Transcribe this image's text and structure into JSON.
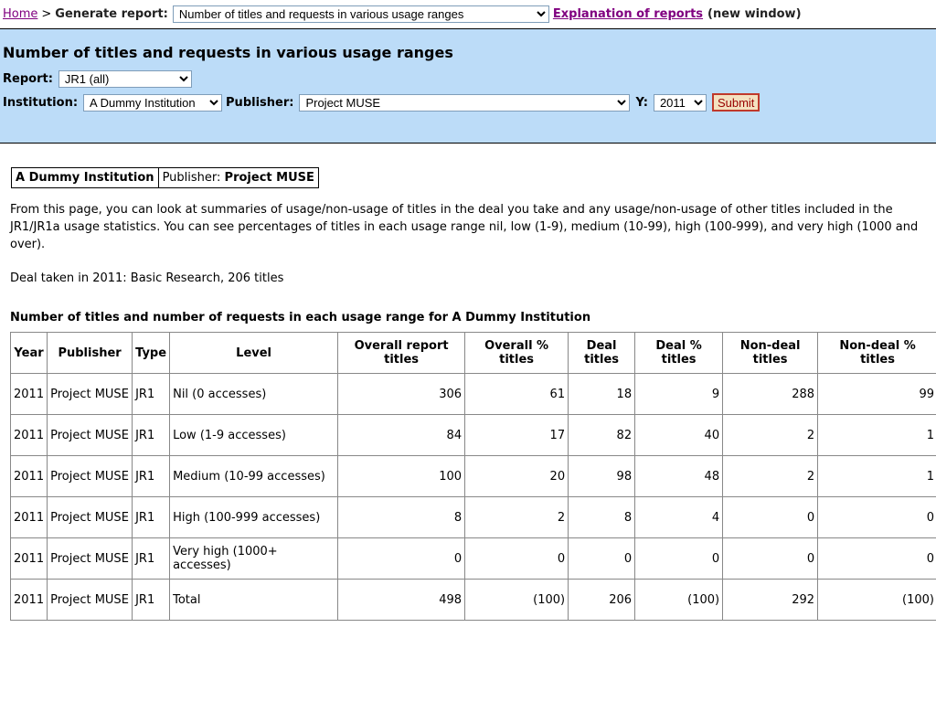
{
  "topbar": {
    "home": "Home",
    "separator": ">",
    "generate_label": "Generate report:",
    "report_select": "Number of titles and requests in various usage ranges",
    "explanation_link": "Explanation of reports",
    "new_window": "(new window)"
  },
  "panel": {
    "title": "Number of titles and requests in various usage ranges",
    "report_label": "Report:",
    "report_value": "JR1 (all)",
    "institution_label": "Institution:",
    "institution_value": "A Dummy Institution",
    "publisher_label": "Publisher:",
    "publisher_value": "Project MUSE",
    "year_label": "Y:",
    "year_value": "2011",
    "submit": "Submit"
  },
  "infobox": {
    "institution": "A Dummy Institution",
    "publisher_label": "Publisher:",
    "publisher": "Project MUSE"
  },
  "intro": "From this page, you can look at summaries of usage/non-usage of titles in the deal you take and any usage/non-usage of other titles included in the JR1/JR1a usage statistics. You can see percentages of titles in each usage range nil, low (1-9), medium (10-99), high (100-999), and very high (1000 and over).",
  "deal_text": "Deal taken in 2011: Basic Research, 206 titles",
  "table_heading": "Number of titles and number of requests in each usage range for A Dummy Institution",
  "table": {
    "headers": [
      "Year",
      "Publisher",
      "Type",
      "Level",
      "Overall report titles",
      "Overall % titles",
      "Deal titles",
      "Deal % titles",
      "Non-deal titles",
      "Non-deal % titles"
    ],
    "rows": [
      [
        "2011",
        "Project MUSE",
        "JR1",
        "Nil (0 accesses)",
        "306",
        "61",
        "18",
        "9",
        "288",
        "99"
      ],
      [
        "2011",
        "Project MUSE",
        "JR1",
        "Low (1-9 accesses)",
        "84",
        "17",
        "82",
        "40",
        "2",
        "1"
      ],
      [
        "2011",
        "Project MUSE",
        "JR1",
        "Medium (10-99 accesses)",
        "100",
        "20",
        "98",
        "48",
        "2",
        "1"
      ],
      [
        "2011",
        "Project MUSE",
        "JR1",
        "High (100-999 accesses)",
        "8",
        "2",
        "8",
        "4",
        "0",
        "0"
      ],
      [
        "2011",
        "Project MUSE",
        "JR1",
        "Very high (1000+ accesses)",
        "0",
        "0",
        "0",
        "0",
        "0",
        "0"
      ],
      [
        "2011",
        "Project MUSE",
        "JR1",
        "Total",
        "498",
        "(100)",
        "206",
        "(100)",
        "292",
        "(100)"
      ]
    ]
  }
}
